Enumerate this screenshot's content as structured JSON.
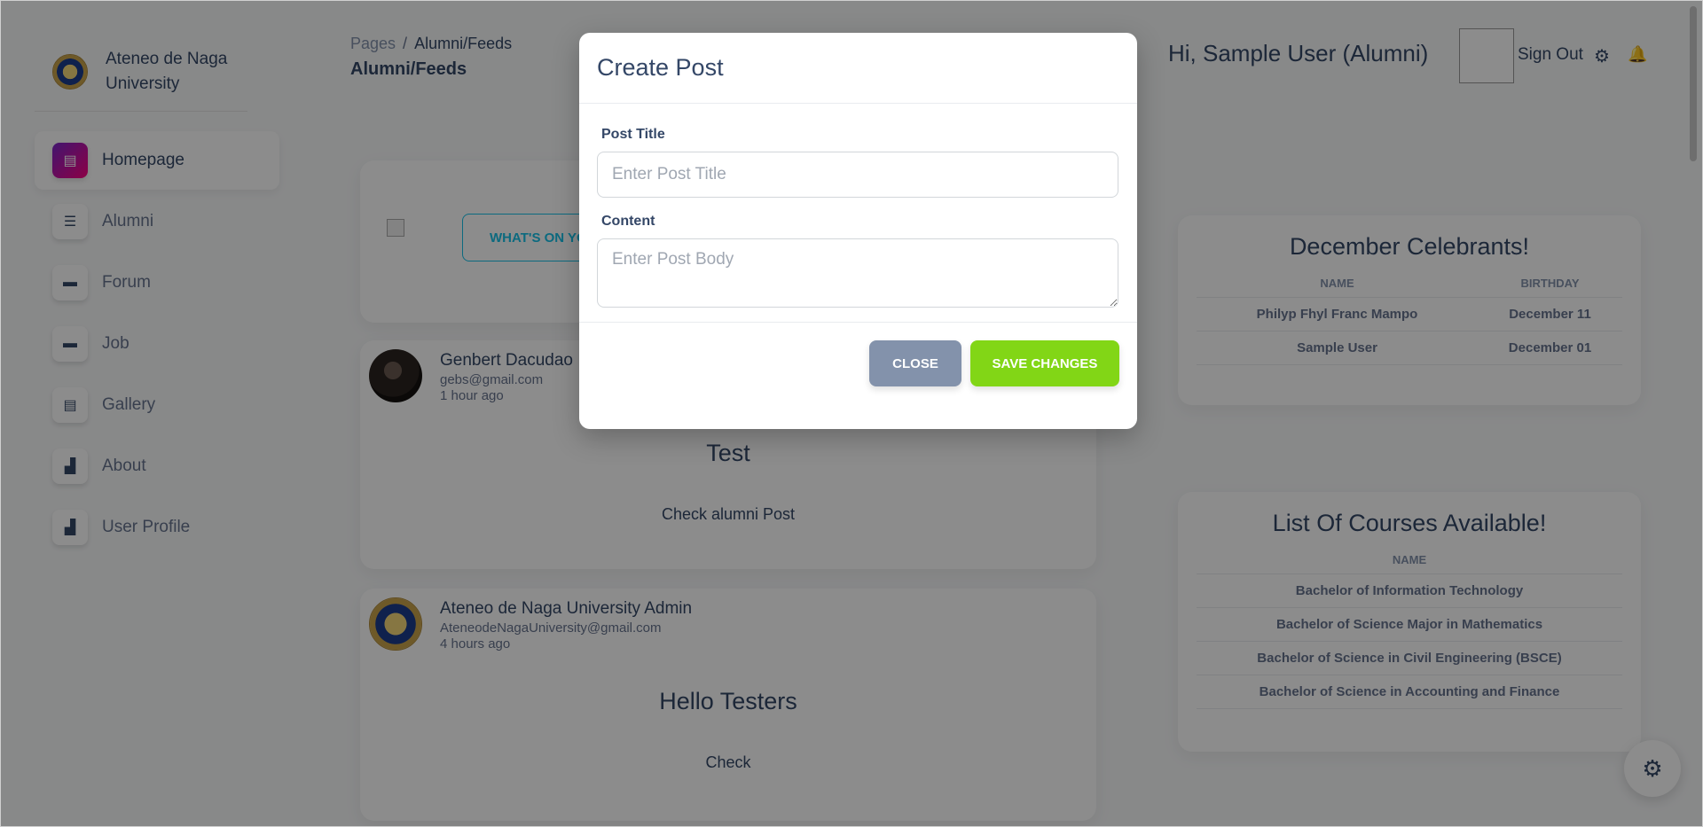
{
  "brand": {
    "name": "Ateneo de Naga University"
  },
  "sidebar": {
    "items": [
      {
        "label": "Homepage",
        "icon": "document-icon",
        "active": true
      },
      {
        "label": "Alumni",
        "icon": "list-icon",
        "active": false
      },
      {
        "label": "Forum",
        "icon": "card-icon",
        "active": false
      },
      {
        "label": "Job",
        "icon": "card-icon",
        "active": false
      },
      {
        "label": "Gallery",
        "icon": "document-icon",
        "active": false
      },
      {
        "label": "About",
        "icon": "user-card-icon",
        "active": false
      },
      {
        "label": "User Profile",
        "icon": "user-card-icon",
        "active": false
      }
    ]
  },
  "header": {
    "breadcrumb_root": "Pages",
    "breadcrumb_sep": "/",
    "breadcrumb_current": "Alumni/Feeds",
    "title": "Alumni/Feeds",
    "greeting": "Hi, Sample User (Alumni)",
    "signout": "Sign Out"
  },
  "composer": {
    "button_label": "WHAT'S ON YOUR MIND?"
  },
  "posts": [
    {
      "author": "Genbert Dacudao",
      "email": "gebs@gmail.com",
      "time": "1 hour ago",
      "title": "Test",
      "body": "Check alumni Post"
    },
    {
      "author": "Ateneo de Naga University Admin",
      "email": "AteneodeNagaUniversity@gmail.com",
      "time": "4 hours ago",
      "title": "Hello Testers",
      "body": "Check"
    }
  ],
  "celebrants": {
    "title": "December Celebrants!",
    "col_name": "NAME",
    "col_birthday": "BIRTHDAY",
    "rows": [
      {
        "name": "Philyp Fhyl Franc Mampo",
        "birthday": "December 11"
      },
      {
        "name": "Sample User",
        "birthday": "December 01"
      }
    ]
  },
  "courses": {
    "title": "List Of Courses Available!",
    "col_name": "NAME",
    "rows": [
      "Bachelor of Information Technology",
      "Bachelor of Science Major in Mathematics",
      "Bachelor of Science in Civil Engineering (BSCE)",
      "Bachelor of Science in Accounting and Finance"
    ]
  },
  "modal": {
    "title": "Create Post",
    "post_title_label": "Post Title",
    "post_title_placeholder": "Enter Post Title",
    "post_title_value": "",
    "content_label": "Content",
    "content_placeholder": "Enter Post Body",
    "content_value": "",
    "close_label": "CLOSE",
    "save_label": "SAVE CHANGES"
  },
  "colors": {
    "primary_text": "#344767",
    "secondary_text": "#67748e",
    "accent_gradient_start": "#7928ca",
    "accent_gradient_end": "#ff0080",
    "info": "#17c1e8",
    "success": "#82d616",
    "secondary_btn": "#8392ab"
  }
}
